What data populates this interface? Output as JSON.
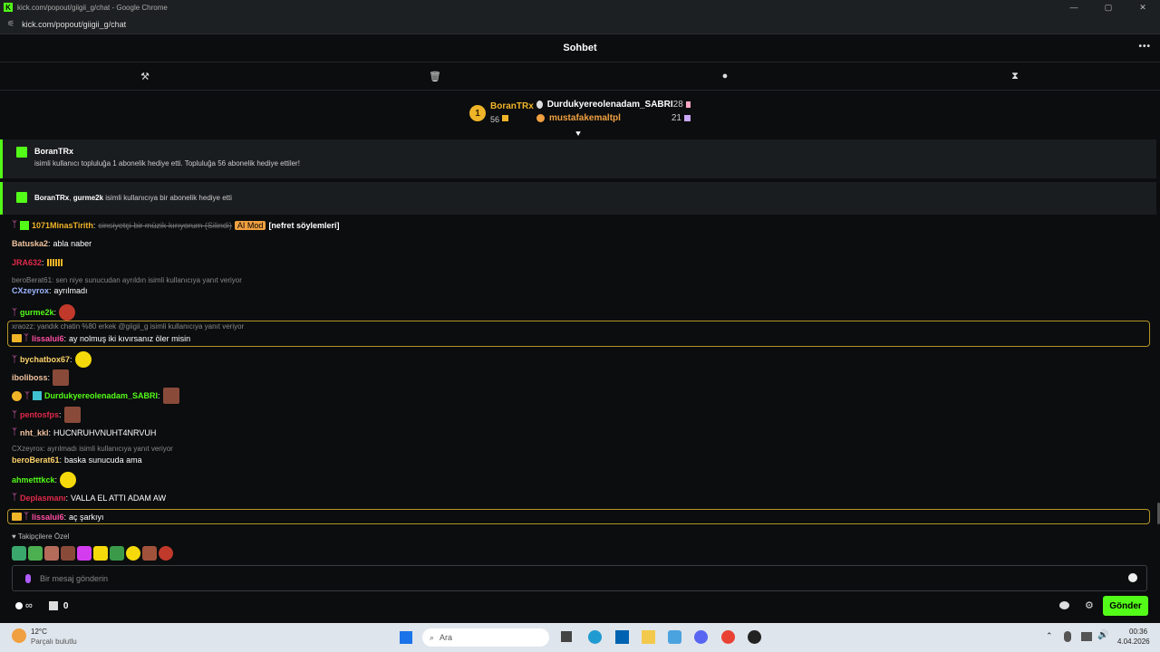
{
  "window": {
    "title": "kick.com/popout/giigii_g/chat - Google Chrome",
    "url": "kick.com/popout/giigii_g/chat",
    "brand_color": "#53fc18"
  },
  "header": {
    "title": "Sohbet",
    "more": "•••"
  },
  "toolbar": {
    "items": [
      {
        "icon": "hammer-icon",
        "glyph": "⚒"
      },
      {
        "icon": "trash-icon",
        "glyph": "🗑"
      },
      {
        "icon": "chat-bubble-icon",
        "glyph": "●"
      },
      {
        "icon": "hourglass-icon",
        "glyph": "⧗"
      }
    ]
  },
  "leaderboard": {
    "first": {
      "rank": "1",
      "name": "BoranTRx",
      "count": "56"
    },
    "others": [
      {
        "name": "Durdukyereolenadam_SABRI",
        "count": "28"
      },
      {
        "name": "mustafakemaltpl",
        "count": "21"
      }
    ]
  },
  "gifts": [
    {
      "user": "BoranTRx",
      "text": "isimli kullanıcı topluluğa 1 abonelik hediye etti. Topluluğa 56 abonelik hediye ettiler!"
    },
    {
      "user": "BoranTRx",
      "sep": ", ",
      "user2": "gurme2k",
      "text": " isimli kullanıcıya bir abonelik hediye etti"
    }
  ],
  "messages": [
    {
      "user": "1071MinasTirith",
      "color": "#f0b429",
      "text": "cinsiyetçi bir müzik kırıyorum (Silindi)",
      "badge": "AI Mod",
      "tag": "[nefret söylemleri]"
    },
    {
      "user": "Batuska2",
      "color": "#f2c3a0",
      "text": "abla naber"
    },
    {
      "user": "JRA632",
      "color": "#e0294a",
      "text": ""
    },
    {
      "reply": "beroBerat61: sen niye sunucudan ayrıldın isimli kullanıcıya yanıt veriyor"
    },
    {
      "user": "CXzeyrox",
      "color": "#9fb6ff",
      "text": "ayrılmadı"
    },
    {
      "user": "gurme2k",
      "color": "#53fc18",
      "text": ""
    },
    {
      "reply": "xraozz: yandık chatin %80 erkek @giigii_g isimli kullanıcıya yanıt veriyor"
    },
    {
      "user": "lissalui6",
      "color": "#ff4fa3",
      "text": "ay nolmuş iki kıvırsanız öler misin"
    },
    {
      "user": "bychatbox67",
      "color": "#ffd36b",
      "text": ""
    },
    {
      "user": "iboliboss",
      "color": "#f2c3a0",
      "text": ""
    },
    {
      "user": "Durdukyereolenadam_SABRI",
      "color": "#53fc18",
      "text": ""
    },
    {
      "user": "pentosfps",
      "color": "#e0294a",
      "text": ""
    },
    {
      "user": "nht_kkl",
      "color": "#f2c3a0",
      "text": "HUCNRUHVNUHT4NRVUH"
    },
    {
      "reply": "CXzeyrox: ayrılmadı isimli kullanıcıya yanıt veriyor"
    },
    {
      "user": "beroBerat61",
      "color": "#ffd36b",
      "text": "baska sunucuda ama"
    },
    {
      "user": "ahmetttkck",
      "color": "#53fc18",
      "text": ""
    },
    {
      "user": "Deplasmanı",
      "color": "#e0294a",
      "text": "VALLA EL ATTI ADAM AW"
    },
    {
      "user": "lissalui6",
      "color": "#ff4fa3",
      "text": "aç şarkıyı"
    }
  ],
  "followers_label": "♥ Takipçilere Özel",
  "input": {
    "placeholder": "Bir mesaj gönderin"
  },
  "bottom": {
    "infinity": "∞",
    "gift_count": "0",
    "send": "Gönder"
  },
  "taskbar": {
    "weather_temp": "12°C",
    "weather_desc": "Parçalı bulutlu",
    "search": "Ara",
    "time": "00:36",
    "date": "4.04.2026"
  }
}
